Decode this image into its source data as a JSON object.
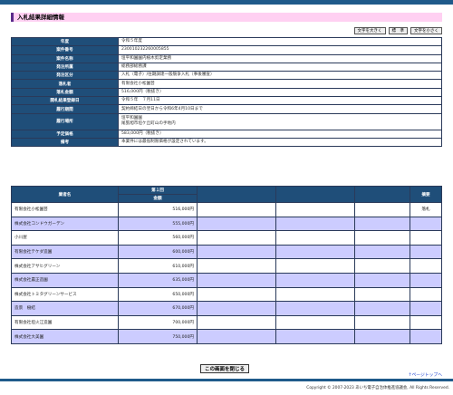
{
  "page": {
    "title": "入札結果詳細情報",
    "font_buttons": [
      "文字を大きく",
      "標　準",
      "文字を小さく"
    ],
    "close_label": "この画面を閉じる",
    "page_top_label": "↑ページトップへ",
    "copyright": "Copyright © 2007-2023 あいち電子自治体推進協議会, All Rights Reserved."
  },
  "info": [
    {
      "label": "年度",
      "value": [
        "令和５年度"
      ]
    },
    {
      "label": "案件番号",
      "value": [
        "230010232260005855"
      ]
    },
    {
      "label": "案件名称",
      "value": [
        "垣平和園園内植木剪定業務"
      ]
    },
    {
      "label": "発注所属",
      "value": [
        "総務部総務課"
      ]
    },
    {
      "label": "発注区分",
      "value": [
        "入札（電子）/往期調達一般競争入札（事後審査）"
      ]
    },
    {
      "label": "落札者",
      "value": [
        "有限会社小松園芸"
      ]
    },
    {
      "label": "落札金額",
      "value": [
        "516,000円（税抜き）"
      ]
    },
    {
      "label": "開札結果登録日",
      "value": [
        "令和５年　７月11日"
      ]
    },
    {
      "label": "履行期間",
      "value": [
        "契約締結日の翌日から令和6年4月10日まで"
      ]
    },
    {
      "label": "履行場所",
      "value": [
        "垣平和園園",
        "尾張旭市垣ケ丘町山の手地内"
      ]
    },
    {
      "label": "予定価格",
      "value": [
        "583,000円（税抜き）"
      ]
    },
    {
      "label": "備考",
      "value": [
        "本業件には最低制限価格が設定されています。"
      ]
    }
  ],
  "results": {
    "col_bidder": "業者名",
    "col_round": "第１回",
    "col_amount": "金額",
    "col_remark": "摘要",
    "rows": [
      {
        "name": "有限会社小松園芸",
        "amount": "516,000円",
        "remark": "落札"
      },
      {
        "name": "株式会社コンドウガーデン",
        "amount": "555,000円",
        "remark": ""
      },
      {
        "name": "小川屋",
        "amount": "560,000円",
        "remark": ""
      },
      {
        "name": "有限会社テケダ造園",
        "amount": "600,000円",
        "remark": ""
      },
      {
        "name": "株式会社アサヒグリーン",
        "amount": "610,000円",
        "remark": ""
      },
      {
        "name": "株式会社農正造園",
        "amount": "635,000円",
        "remark": ""
      },
      {
        "name": "株式会社トミタグリーンサービス",
        "amount": "650,000円",
        "remark": ""
      },
      {
        "name": "造景　樹結",
        "amount": "670,000円",
        "remark": ""
      },
      {
        "name": "有限会社垣火江造園",
        "amount": "700,000円",
        "remark": ""
      },
      {
        "name": "株式会社大美園",
        "amount": "750,000円",
        "remark": ""
      }
    ]
  }
}
